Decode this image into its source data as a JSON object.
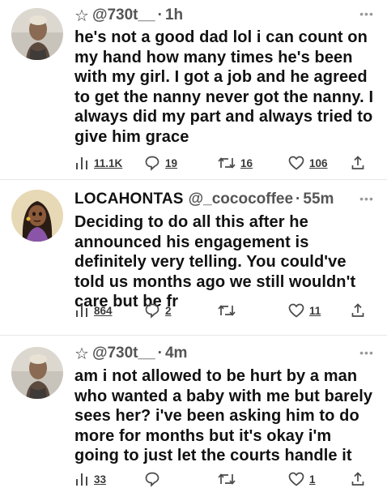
{
  "tweets": [
    {
      "star": "☆",
      "name": "",
      "handle": "@730t__",
      "time": "1h",
      "more": "•••",
      "text": "he's not a good dad lol i can count on my hand how many times he's been with my girl. I got a job and he agreed to get the nanny never got the nanny. I always did my part and always tried to give him grace",
      "views": "11.1K",
      "replies": "19",
      "retweets": "16",
      "likes": "106"
    },
    {
      "star": "",
      "name": "LOCAHONTAS",
      "handle": "@_cococoffee",
      "time": "55m",
      "more": "•••",
      "text": "Deciding to do all this after he announced his engagement is definitely very telling. You could've told us months ago we still wouldn't care but be fr",
      "views": "864",
      "replies": "2",
      "retweets": "",
      "likes": "11"
    },
    {
      "star": "☆",
      "name": "",
      "handle": "@730t__",
      "time": "4m",
      "more": "•••",
      "text": "am i not allowed to be hurt by a man who wanted a baby with me but barely sees her? i've been asking him to do more for months but it's okay i'm going to just let the courts handle it",
      "views": "33",
      "replies": "",
      "retweets": "",
      "likes": "1"
    }
  ],
  "icons": {
    "views": "bar-chart-icon",
    "reply": "speech-bubble-icon",
    "retweet": "retweet-arrows-icon",
    "like": "heart-icon",
    "share": "share-upload-icon"
  },
  "colors": {
    "icon": "#4a4a4a",
    "divider": "#e6e6e6"
  }
}
